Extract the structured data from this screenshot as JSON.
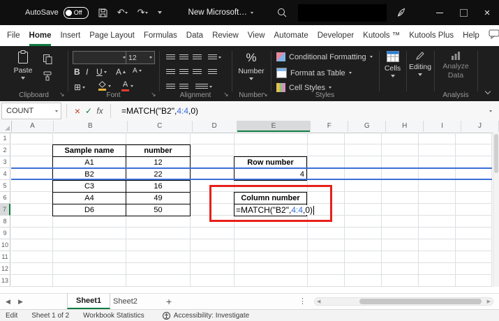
{
  "titlebar": {
    "autosave_label": "AutoSave",
    "autosave_state": "Off",
    "doc_title": "New Microsoft…",
    "undo_glyph": "↶",
    "redo_glyph": "↷",
    "close_glyph": "×"
  },
  "menubar": {
    "active_tab": "Home",
    "tabs": [
      {
        "label": "File"
      },
      {
        "label": "Home"
      },
      {
        "label": "Insert"
      },
      {
        "label": "Page Layout"
      },
      {
        "label": "Formulas"
      },
      {
        "label": "Data"
      },
      {
        "label": "Review"
      },
      {
        "label": "View"
      },
      {
        "label": "Automate"
      },
      {
        "label": "Developer"
      },
      {
        "label": "Kutools ™"
      },
      {
        "label": "Kutools Plus"
      },
      {
        "label": "Help"
      }
    ]
  },
  "ribbon": {
    "paste_label": "Paste",
    "clipboard_group_label": "Clipboard",
    "dialog_launcher_glyph": "↘",
    "font_name_value": "",
    "font_size_value": "12",
    "bold_glyph": "B",
    "italic_glyph": "I",
    "underline_glyph": "U",
    "grow_font_glyph": "A",
    "shrink_font_glyph": "A",
    "borders_glyph": "⊞",
    "font_color_glyph": "A",
    "font_group_label": "Font",
    "alignment_group_label": "Alignment",
    "percent_glyph": "%",
    "number_button_label": "Number",
    "number_group_label": "Number",
    "styles_items": [
      {
        "label": "Conditional Formatting"
      },
      {
        "label": "Format as Table"
      },
      {
        "label": "Cell Styles"
      }
    ],
    "styles_group_label": "Styles",
    "cells_button_label": "Cells",
    "editing_button_label": "Editing",
    "analyze_line1": "Analyze",
    "analyze_line2": "Data",
    "analysis_group_label": "Analysis"
  },
  "formula_bar": {
    "name_box_value": "COUNT",
    "cancel_glyph": "×",
    "enter_glyph": "✓",
    "fx_label": "fx",
    "formula_prefix": "=MATCH(\"B2\",",
    "formula_ref": "4:4",
    "formula_suffix": ",0)"
  },
  "grid": {
    "column_headers": [
      "A",
      "B",
      "C",
      "D",
      "E",
      "F",
      "G",
      "H",
      "I",
      "J"
    ],
    "row_headers": [
      "1",
      "2",
      "3",
      "4",
      "5",
      "6",
      "7",
      "8",
      "9",
      "10",
      "11",
      "12",
      "13"
    ],
    "selected_column": "E",
    "selected_row": "7",
    "sample_table": {
      "header": [
        "Sample name",
        "number"
      ],
      "rows": [
        [
          "A1",
          "12"
        ],
        [
          "B2",
          "22"
        ],
        [
          "C3",
          "16"
        ],
        [
          "A4",
          "49"
        ],
        [
          "D6",
          "50"
        ]
      ]
    },
    "row_number_box": {
      "label": "Row number",
      "value": "4"
    },
    "column_number_box": {
      "label": "Column number"
    },
    "cell_formula": {
      "prefix": "=MATCH(\"B2\",",
      "ref": "4:4",
      "suffix": ",0)"
    }
  },
  "sheet_bar": {
    "prev_glyph": "◀",
    "next_glyph": "▶",
    "sheets": [
      {
        "name": "Sheet1"
      },
      {
        "name": "Sheet2"
      }
    ],
    "active_sheet": "Sheet1",
    "add_glyph": "+",
    "more_glyph": "⋮"
  },
  "status_bar": {
    "mode": "Edit",
    "sheet_info": "Sheet 1 of 2",
    "workbook_statistics": "Workbook Statistics",
    "accessibility_label": "Accessibility: Investigate"
  },
  "colors": {
    "excel_green": "#107C41",
    "reference_blue": "#3a6fd8",
    "annotation_red": "#e8201a",
    "titlebar_bg": "#0f0f0f",
    "ribbon_bg": "#1e1e1e"
  }
}
